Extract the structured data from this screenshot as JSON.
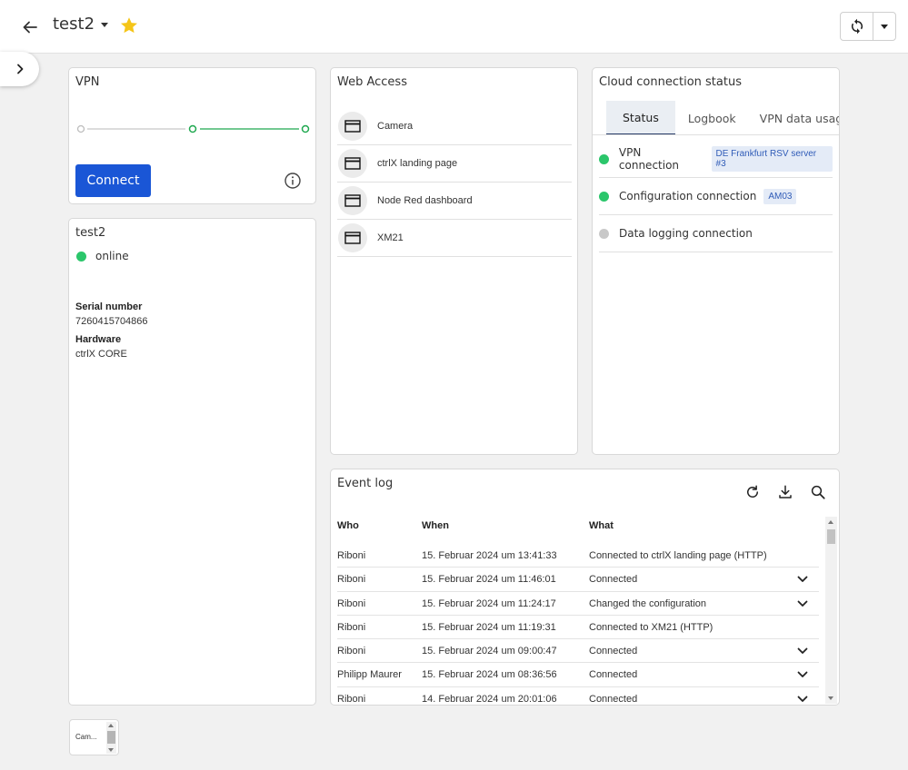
{
  "header": {
    "title": "test2",
    "favorite": true,
    "icons": {
      "back": "arrow-left-icon",
      "star": "star-icon",
      "refresh": "sync-icon",
      "dropdown": "caret-down-icon"
    }
  },
  "colors": {
    "primary": "#1a56d6",
    "online": "#2bc66b",
    "offline": "#c8c8c8",
    "star": "#f5c518",
    "vpn_line": "#1fa84f"
  },
  "vpn": {
    "title": "VPN",
    "connect_label": "Connect"
  },
  "device": {
    "name": "test2",
    "status": "online",
    "serial_label": "Serial number",
    "serial_value": "7260415704866",
    "hardware_label": "Hardware",
    "hardware_value": "ctrlX CORE"
  },
  "web_access": {
    "title": "Web Access",
    "items": [
      {
        "label": "Camera"
      },
      {
        "label": "ctrlX landing page"
      },
      {
        "label": "Node Red dashboard"
      },
      {
        "label": "XM21"
      }
    ]
  },
  "cloud": {
    "title": "Cloud connection status",
    "tabs": [
      "Status",
      "Logbook",
      "VPN data usage"
    ],
    "active_tab": "Status",
    "connections": [
      {
        "label": "VPN connection",
        "tag": "DE Frankfurt RSV server #3",
        "state": "connected"
      },
      {
        "label": "Configuration connection",
        "tag": "AM03",
        "state": "connected"
      },
      {
        "label": "Data logging connection",
        "tag": "",
        "state": "disconnected"
      }
    ]
  },
  "event_log": {
    "title": "Event log",
    "columns": [
      "Who",
      "When",
      "What"
    ],
    "rows": [
      {
        "who": "Riboni",
        "when": "15. Februar 2024 um 13:41:33",
        "what": "Connected to ctrlX landing page (HTTP)",
        "expandable": false
      },
      {
        "who": "Riboni",
        "when": "15. Februar 2024 um 11:46:01",
        "what": "Connected",
        "expandable": true
      },
      {
        "who": "Riboni",
        "when": "15. Februar 2024 um 11:24:17",
        "what": "Changed the configuration",
        "expandable": true
      },
      {
        "who": "Riboni",
        "when": "15. Februar 2024 um 11:19:31",
        "what": "Connected to XM21 (HTTP)",
        "expandable": false
      },
      {
        "who": "Riboni",
        "when": "15. Februar 2024 um 09:00:47",
        "what": "Connected",
        "expandable": true
      },
      {
        "who": "Philipp Maurer",
        "when": "15. Februar 2024 um 08:36:56",
        "what": "Connected",
        "expandable": true
      },
      {
        "who": "Riboni",
        "when": "14. Februar 2024 um 20:01:06",
        "what": "Connected",
        "expandable": true
      }
    ]
  },
  "mini_widget": {
    "label": "Cam..."
  }
}
